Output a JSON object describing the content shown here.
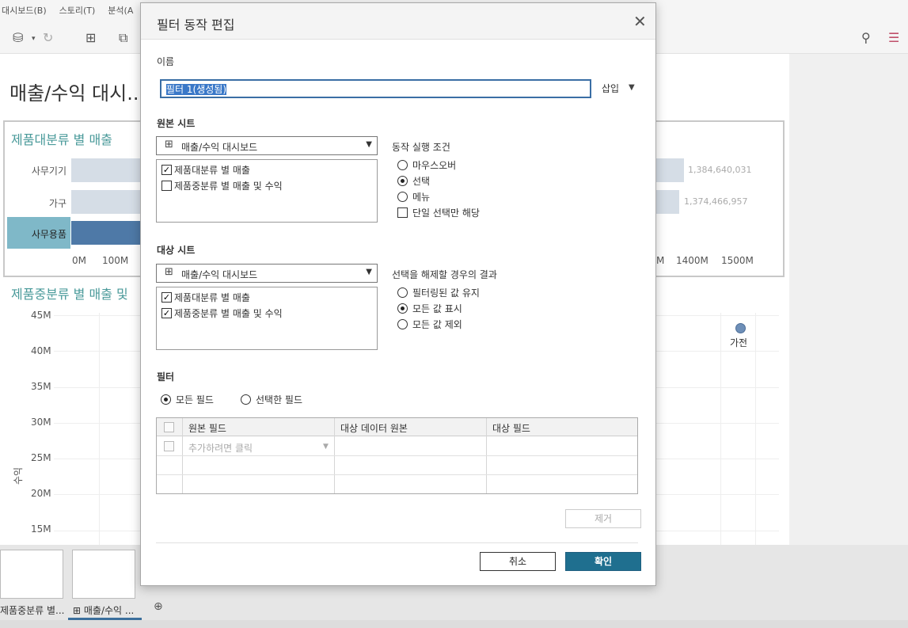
{
  "app": {
    "menu": [
      "대시보드(B)",
      "스토리(T)",
      "분석(A"
    ],
    "dashboard_title": "매출/수익 대시...",
    "zone1_title": "제품대분류 별 매출",
    "zone2_title": "제품중분류 별 매출 및",
    "bars": [
      {
        "label": "사무기기",
        "value_label": "1,384,640,031"
      },
      {
        "label": "가구",
        "value_label": "1,374,466,957"
      },
      {
        "label": "사무용품",
        "value_label": ""
      }
    ],
    "x_ticks": [
      "0M",
      "100M",
      "M",
      "1400M",
      "1500M"
    ],
    "y_ticks": [
      "45M",
      "40M",
      "35M",
      "30M",
      "25M",
      "20M",
      "15M"
    ],
    "y_axis_label": "수익",
    "point_label": "가전",
    "tabs": [
      {
        "label": "제품중분류 별..."
      },
      {
        "label": "매출/수익 ..."
      }
    ]
  },
  "dialog": {
    "title": "필터 동작 편집",
    "name_label": "이름",
    "name_value": "필터 1(생성됨)",
    "insert_label": "삽입",
    "source_label": "원본 시트",
    "source_select": "매출/수익 대시보드",
    "source_items": [
      {
        "label": "제품대분류 별 매출",
        "checked": true
      },
      {
        "label": "제품중분류 별 매출 및 수익",
        "checked": false
      }
    ],
    "run_on_label": "동작 실행 조건",
    "run_on_options": [
      {
        "label": "마우스오버",
        "selected": false
      },
      {
        "label": "선택",
        "selected": true
      },
      {
        "label": "메뉴",
        "selected": false
      }
    ],
    "single_select_label": "단일 선택만 해당",
    "target_label": "대상 시트",
    "target_select": "매출/수익 대시보드",
    "target_items": [
      {
        "label": "제품대분류 별 매출",
        "checked": true
      },
      {
        "label": "제품중분류 별 매출 및 수익",
        "checked": true
      }
    ],
    "clear_label": "선택을 해제할 경우의 결과",
    "clear_options": [
      {
        "label": "필터링된 값 유지",
        "selected": false
      },
      {
        "label": "모든 값 표시",
        "selected": true
      },
      {
        "label": "모든 값 제외",
        "selected": false
      }
    ],
    "filter_label": "필터",
    "filter_all": "모든 필드",
    "filter_selected": "선택한 필드",
    "grid_headers": [
      "원본 필드",
      "대상 데이터 원본",
      "대상 필드"
    ],
    "grid_placeholder": "추가하려면 클릭",
    "remove_label": "제거",
    "cancel_label": "취소",
    "ok_label": "확인"
  }
}
